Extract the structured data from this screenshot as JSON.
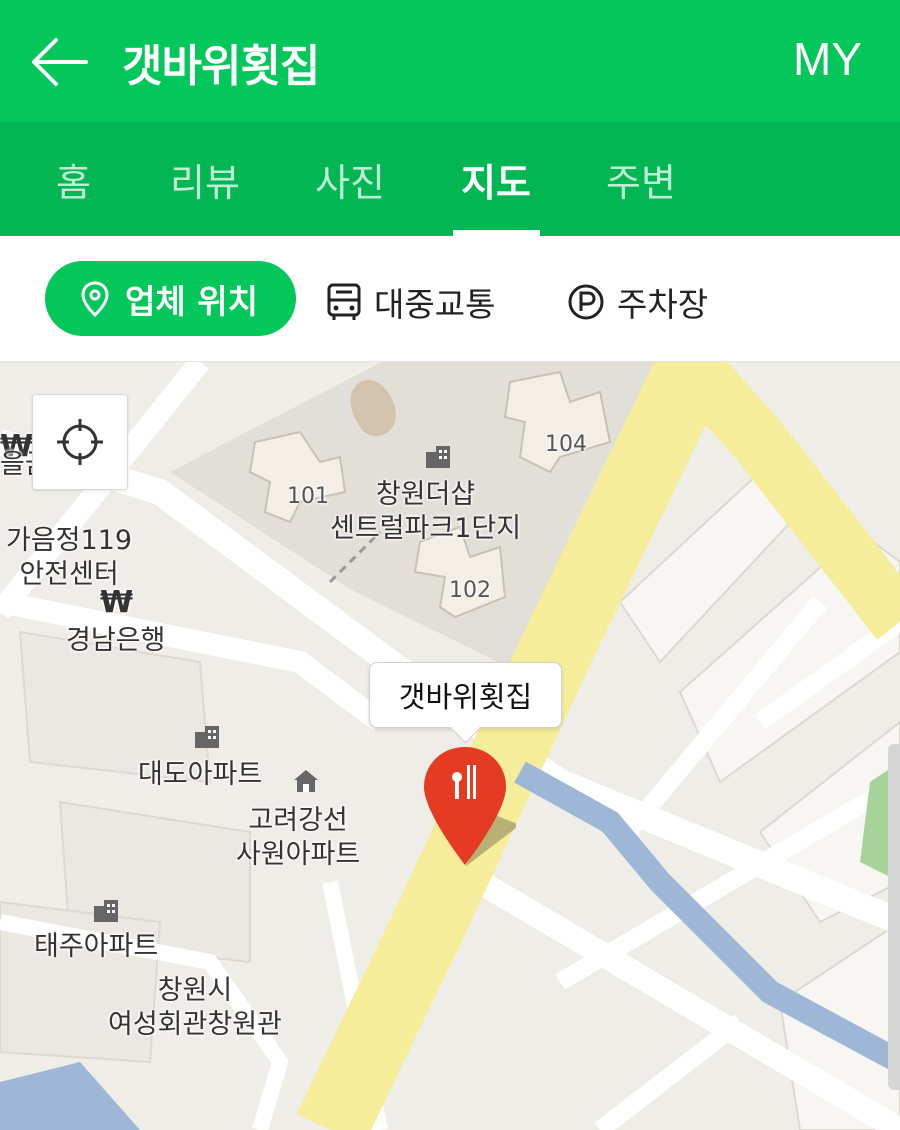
{
  "header": {
    "title": "갯바위횟집",
    "my_label": "MY"
  },
  "tabs": [
    {
      "label": "홈",
      "active": false
    },
    {
      "label": "리뷰",
      "active": false
    },
    {
      "label": "사진",
      "active": false
    },
    {
      "label": "지도",
      "active": true
    },
    {
      "label": "주변",
      "active": false
    }
  ],
  "filters": {
    "location": "업체 위치",
    "transit": "대중교통",
    "parking": "주차장"
  },
  "map": {
    "callout": "갯바위횟집",
    "labels": {
      "apt_complex_line1": "창원더샵",
      "apt_complex_line2": "센트럴파크1단지",
      "bldg_101": "101",
      "bldg_102": "102",
      "bldg_104": "104",
      "fire_station_line1": "가음정119",
      "fire_station_line2": "안전센터",
      "bank": "경남은행",
      "daedo_apt": "대도아파트",
      "goryeo_line1": "고려강선",
      "goryeo_line2": "사원아파트",
      "taeju_apt": "태주아파트",
      "women_hall_line1": "창원시",
      "women_hall_line2": "여성회관창원관",
      "cut_top_left": "을금고"
    },
    "colors": {
      "accent": "#03c75a",
      "road_main": "#f6ed9b",
      "water": "#9fb7d6",
      "pin": "#e53b22"
    }
  }
}
